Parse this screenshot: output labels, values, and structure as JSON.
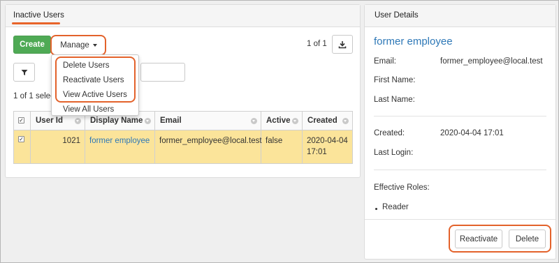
{
  "inactive_users": {
    "title": "Inactive Users",
    "create_label": "Create",
    "manage_label": "Manage",
    "pager": "1 of 1",
    "selection_status": "1 of 1 selec",
    "manage_menu": {
      "items": [
        "Delete Users",
        "Reactivate Users",
        "View Active Users",
        "View All Users"
      ]
    },
    "table": {
      "headers": [
        "User Id",
        "Display Name",
        "Email",
        "Active",
        "Created"
      ],
      "rows": [
        {
          "selected": true,
          "user_id": "1021",
          "display_name": "former employee",
          "email": "former_employee@local.test",
          "active": "false",
          "created_date": "2020-04-04",
          "created_time": "17:01"
        }
      ]
    }
  },
  "user_details": {
    "title": "User Details",
    "name": "former employee",
    "email_label": "Email:",
    "email_value": "former_employee@local.test",
    "first_name_label": "First Name:",
    "last_name_label": "Last Name:",
    "created_label": "Created:",
    "created_value": "2020-04-04 17:01",
    "last_login_label": "Last Login:",
    "effective_roles_label": "Effective Roles:",
    "roles": [
      "Reader"
    ],
    "reactivate_label": "Reactivate",
    "delete_label": "Delete"
  },
  "icons": {
    "export": "download-icon",
    "filter": "filter-icon",
    "sort": "sort-indicator-icon"
  },
  "colors": {
    "accent_highlight": "#e3622b",
    "create_button": "#4faa55",
    "link": "#2e78b7",
    "selected_row": "#fbe49a"
  }
}
